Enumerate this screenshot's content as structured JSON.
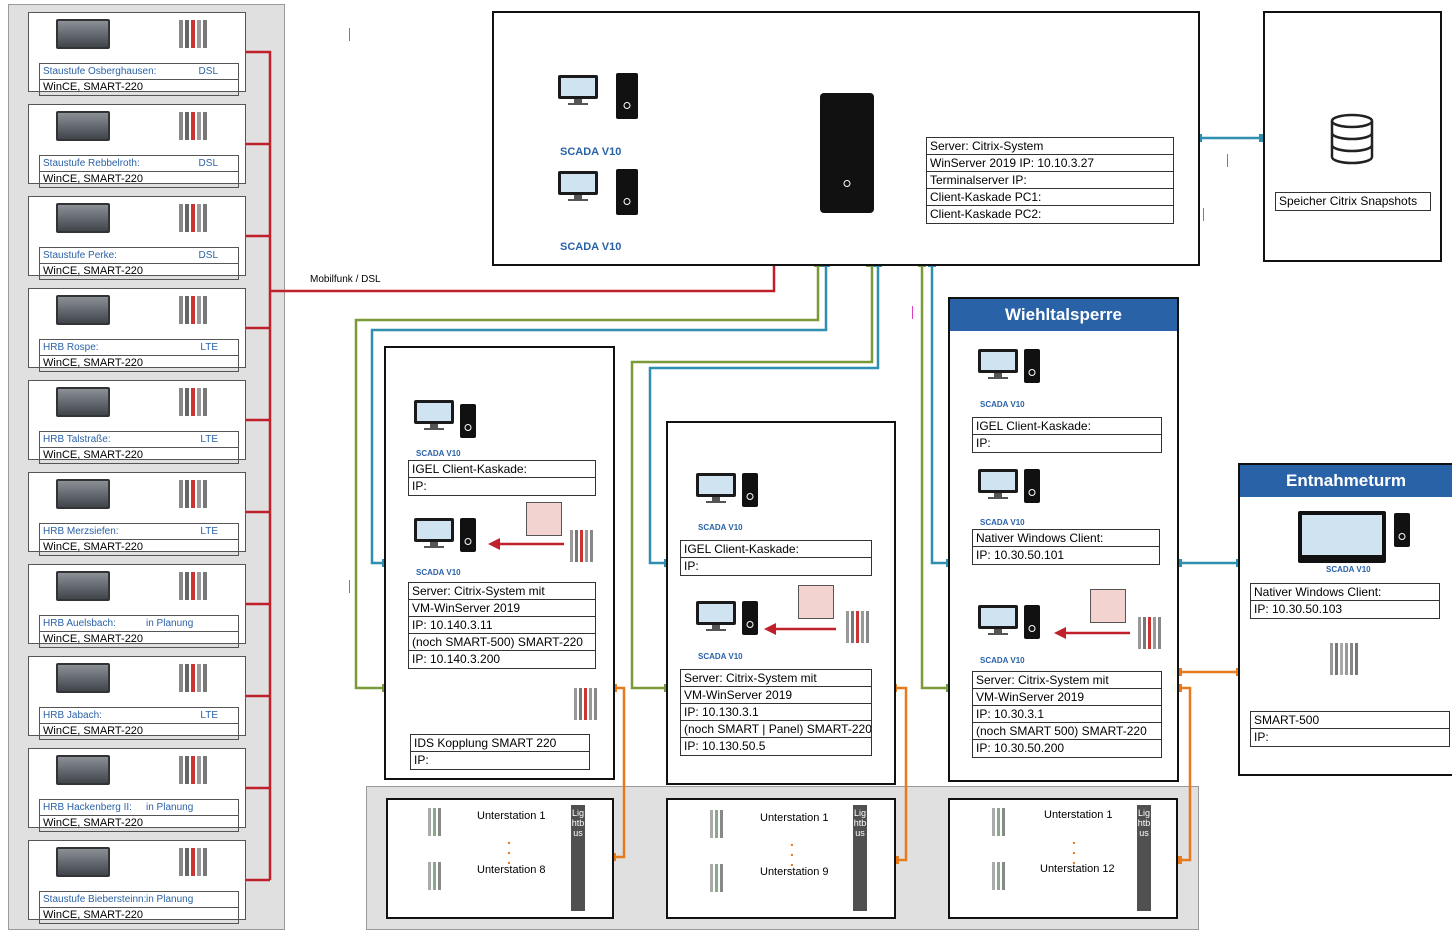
{
  "stations": [
    {
      "name": "Staustufe Osberghausen:",
      "link": "DSL",
      "system": "WinCE, SMART-220"
    },
    {
      "name": "Staustufe Rebbelroth:",
      "link": "DSL",
      "system": "WinCE, SMART-220"
    },
    {
      "name": "Staustufe Perke:",
      "link": "DSL",
      "system": "WinCE, SMART-220"
    },
    {
      "name": "HRB Rospe:",
      "link": "LTE",
      "system": "WinCE, SMART-220"
    },
    {
      "name": "HRB Talstraße:",
      "link": "LTE",
      "system": "WinCE, SMART-220"
    },
    {
      "name": "HRB Merzsiefen:",
      "link": "LTE",
      "system": "WinCE, SMART-220"
    },
    {
      "name": "HRB Auelsbach:",
      "link": "in Planung",
      "system": "WinCE, SMART-220"
    },
    {
      "name": "HRB Jabach:",
      "link": "LTE",
      "system": "WinCE, SMART-220"
    },
    {
      "name": "HRB Hackenberg II:",
      "link": "in Planung",
      "system": "WinCE, SMART-220"
    },
    {
      "name": "Staustufe Biebersteinn:",
      "link": "in Planung",
      "system": "WinCE, SMART-220"
    }
  ],
  "mobilfunk_label": "Mobilfunk / DSL",
  "scada_label": "SCADA V10",
  "main_server": {
    "rows": [
      "Server: Citrix-System",
      "WinServer 2019     IP: 10.10.3.27",
      "Terminalserver        IP:",
      "Client-Kaskade PC1:",
      "Client-Kaskade PC2:"
    ]
  },
  "snapshot": {
    "label": "Speicher Citrix Snapshots"
  },
  "site1": {
    "igel": [
      "IGEL Client-Kaskade:",
      "IP:"
    ],
    "server": [
      "Server: Citrix-System mit",
      "VM-WinServer 2019",
      " IP: 10.140.3.11",
      "(noch SMART-500) SMART-220",
      "IP: 10.140.3.200"
    ],
    "ids": [
      "IDS Kopplung SMART 220",
      "IP:"
    ],
    "sub_first": "Unterstation 1",
    "sub_last": "Unterstation 8"
  },
  "site2": {
    "igel": [
      "IGEL Client-Kaskade:",
      "IP:"
    ],
    "server": [
      "Server: Citrix-System mit",
      "VM-WinServer 2019",
      " IP: 10.130.3.1",
      "(noch SMART | Panel) SMART-220",
      "IP: 10.130.50.5"
    ],
    "sub_first": "Unterstation 1",
    "sub_last": "Unterstation 9"
  },
  "site3": {
    "title": "Wiehltalsperre",
    "igel": [
      "IGEL Client-Kaskade:",
      "IP:"
    ],
    "native": [
      "Nativer Windows Client:",
      "IP: 10.30.50.101"
    ],
    "server": [
      "Server: Citrix-System mit",
      "VM-WinServer 2019",
      " IP: 10.30.3.1",
      "(noch SMART 500) SMART-220",
      "IP: 10.30.50.200"
    ],
    "sub_first": "Unterstation 1",
    "sub_last": "Unterstation 12"
  },
  "site4": {
    "title": "Entnahmeturm",
    "native": [
      "Nativer Windows Client:",
      "IP: 10.30.50.103"
    ],
    "smart": [
      "SMART-500",
      "IP:"
    ]
  },
  "lightbus": "Lightbus",
  "colors": {
    "red": "#c0202a",
    "green": "#7a9a3a",
    "blue": "#2f8fb0",
    "orange": "#e87a1e",
    "header": "#2a62a8"
  }
}
